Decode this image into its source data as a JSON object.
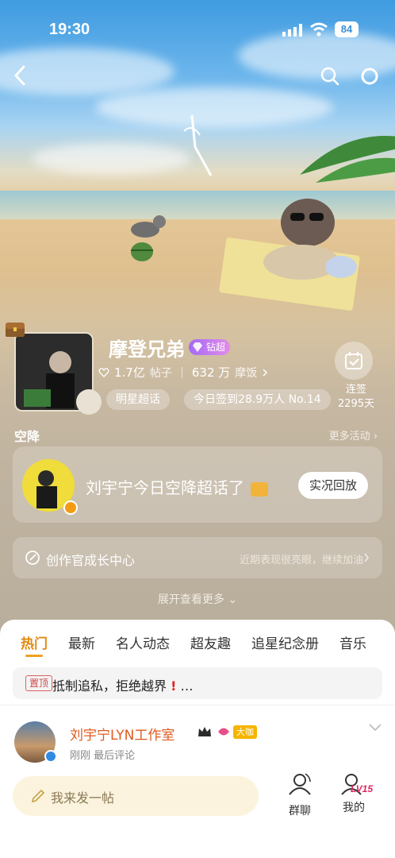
{
  "status_bar": {
    "time": "19:30",
    "battery": "84"
  },
  "header": {
    "name": "摩登兄弟",
    "level_badge": "钻超",
    "posts_count": "1.7亿",
    "posts_label": "帖子",
    "fans_count": "632 万",
    "fans_label": "摩饭",
    "tag_star": "明星超话",
    "checkin_today": "今日签到28.9万人 No.14",
    "streak_label": "连签",
    "streak_days": "2295天"
  },
  "airdrop": {
    "section_title": "空降",
    "more_label": "更多活动",
    "card_text": "刘宇宁今日空降超话了",
    "replay_button": "实况回放"
  },
  "creator_center": {
    "label": "创作官成长中心",
    "hint": "近期表现很亮眼，继续加油"
  },
  "expand_label": "展开查看更多",
  "tabs": [
    "热门",
    "最新",
    "名人动态",
    "超友趣",
    "追星纪念册",
    "音乐"
  ],
  "pinned": {
    "tag": "置顶",
    "text": "抵制追私，拒绝越界",
    "ellipsis": "…"
  },
  "post": {
    "author": "刘宇宁LYN工作室",
    "role_tag": "大咖",
    "meta": "刚刚 最后评论"
  },
  "bottom_bar": {
    "compose_placeholder": "我来发一帖",
    "group_chat": "群聊",
    "mine": "我的",
    "mine_level": "LV15"
  },
  "colors": {
    "accent": "#e28a12",
    "brand_orange": "#e05a1e",
    "compose_bg": "#fbf3dd"
  }
}
